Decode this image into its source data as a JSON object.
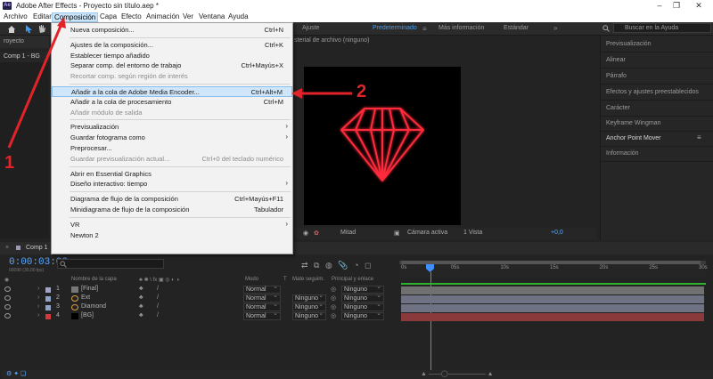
{
  "window": {
    "title": "Adobe After Effects - Proyecto sin título.aep *",
    "logo": "Ae",
    "controls": [
      "minimize-icon",
      "maximize-icon",
      "close-icon"
    ]
  },
  "menubar": [
    "Archivo",
    "Editar",
    "Composición",
    "Capa",
    "Efecto",
    "Animación",
    "Ver",
    "Ventana",
    "Ayuda"
  ],
  "active_menu": "Composición",
  "toolbar": {
    "ajuste": "Ajuste",
    "workspaces": [
      "Predeterminado",
      "Más información",
      "Estándar"
    ],
    "active_workspace": "Predeterminado",
    "search_placeholder": "Buscar en la Ayuda"
  },
  "project_panel": {
    "tab": "royecto",
    "comp_tab": "Comp 1 - BG"
  },
  "viewer": {
    "header": "sterial de archivo (ninguno)",
    "footer": {
      "quality": "Mitad",
      "camera": "Cámara activa",
      "views": "1 Vista",
      "exposure": "+0,0"
    }
  },
  "right_panel": [
    "Previsualización",
    "Alinear",
    "Párrafo",
    "Efectos y ajustes preestablecidos",
    "Carácter",
    "Keyframe Wingman",
    "Anchor Point Mover",
    "Información"
  ],
  "composition_menu": {
    "items": [
      {
        "label": "Nueva composición...",
        "shortcut": "Ctrl+N",
        "disabled": false
      },
      {
        "sep": true
      },
      {
        "label": "Ajustes de la composición...",
        "shortcut": "Ctrl+K",
        "disabled": false
      },
      {
        "label": "Establecer tiempo añadido",
        "shortcut": "",
        "disabled": false
      },
      {
        "label": "Separar comp. del entorno de trabajo",
        "shortcut": "Ctrl+Mayús+X",
        "disabled": false
      },
      {
        "label": "Recortar comp. según región de interés",
        "shortcut": "",
        "disabled": true
      },
      {
        "sep": true
      },
      {
        "label": "Añadir a la cola de Adobe Media Encoder...",
        "shortcut": "Ctrl+Alt+M",
        "disabled": false,
        "highlighted": true
      },
      {
        "label": "Añadir a la cola de procesamiento",
        "shortcut": "Ctrl+M",
        "disabled": false
      },
      {
        "label": "Añadir módulo de salida",
        "shortcut": "",
        "disabled": true
      },
      {
        "sep": true
      },
      {
        "label": "Previsualización",
        "shortcut": "",
        "submenu": true
      },
      {
        "label": "Guardar fotograma como",
        "shortcut": "",
        "submenu": true
      },
      {
        "label": "Preprocesar...",
        "shortcut": ""
      },
      {
        "label": "Guardar previsualización actual...",
        "shortcut": "Ctrl+0 del teclado numérico",
        "disabled": true
      },
      {
        "sep": true
      },
      {
        "label": "Abrir en Essential Graphics",
        "shortcut": ""
      },
      {
        "label": "Diseño interactivo: tiempo",
        "shortcut": "",
        "submenu": true
      },
      {
        "sep": true
      },
      {
        "label": "Diagrama de flujo de la composición",
        "shortcut": "Ctrl+Mayús+F11"
      },
      {
        "label": "Minidiagrama de flujo de la composición",
        "shortcut": "Tabulador"
      },
      {
        "sep": true
      },
      {
        "label": "VR",
        "shortcut": "",
        "submenu": true
      },
      {
        "label": "Newton 2",
        "shortcut": ""
      }
    ]
  },
  "timeline": {
    "tab": "Comp 1",
    "timecode": "0:00:03:00",
    "timecode_sub": "00090 (30,00 fps)",
    "columns": [
      "Nombre de la capa",
      "Modo",
      "T",
      "Mate seguim.",
      "Principal y enlace"
    ],
    "ruler": [
      "0s",
      "05s",
      "10s",
      "15s",
      "20s",
      "25s",
      "30s"
    ],
    "layers": [
      {
        "num": "1",
        "name": "[Final]",
        "mode": "Normal",
        "track": "",
        "parent": "Ninguno",
        "color": "#a3a3c8",
        "bar": "#707070",
        "type": "precomp"
      },
      {
        "num": "2",
        "name": "Ext",
        "mode": "Normal",
        "track": "Ninguno",
        "parent": "Ninguno",
        "color": "#8fa3c8",
        "bar": "#6f7283",
        "type": "shape"
      },
      {
        "num": "3",
        "name": "Diamond",
        "mode": "Normal",
        "track": "Ninguno",
        "parent": "Ninguno",
        "color": "#8fa3c8",
        "bar": "#6f7283",
        "type": "shape"
      },
      {
        "num": "4",
        "name": "[BG]",
        "mode": "Normal",
        "track": "Ninguno",
        "parent": "Ninguno",
        "color": "#d13a3a",
        "bar": "#8a3a3a",
        "type": "solid"
      }
    ]
  },
  "annotations": {
    "step1": "1",
    "step2": "2",
    "color": "#e2232a"
  },
  "colors": {
    "accent": "#3fa0ff",
    "diamond": "#ff2a3a",
    "menu_highlight": "#cfe6fa"
  }
}
